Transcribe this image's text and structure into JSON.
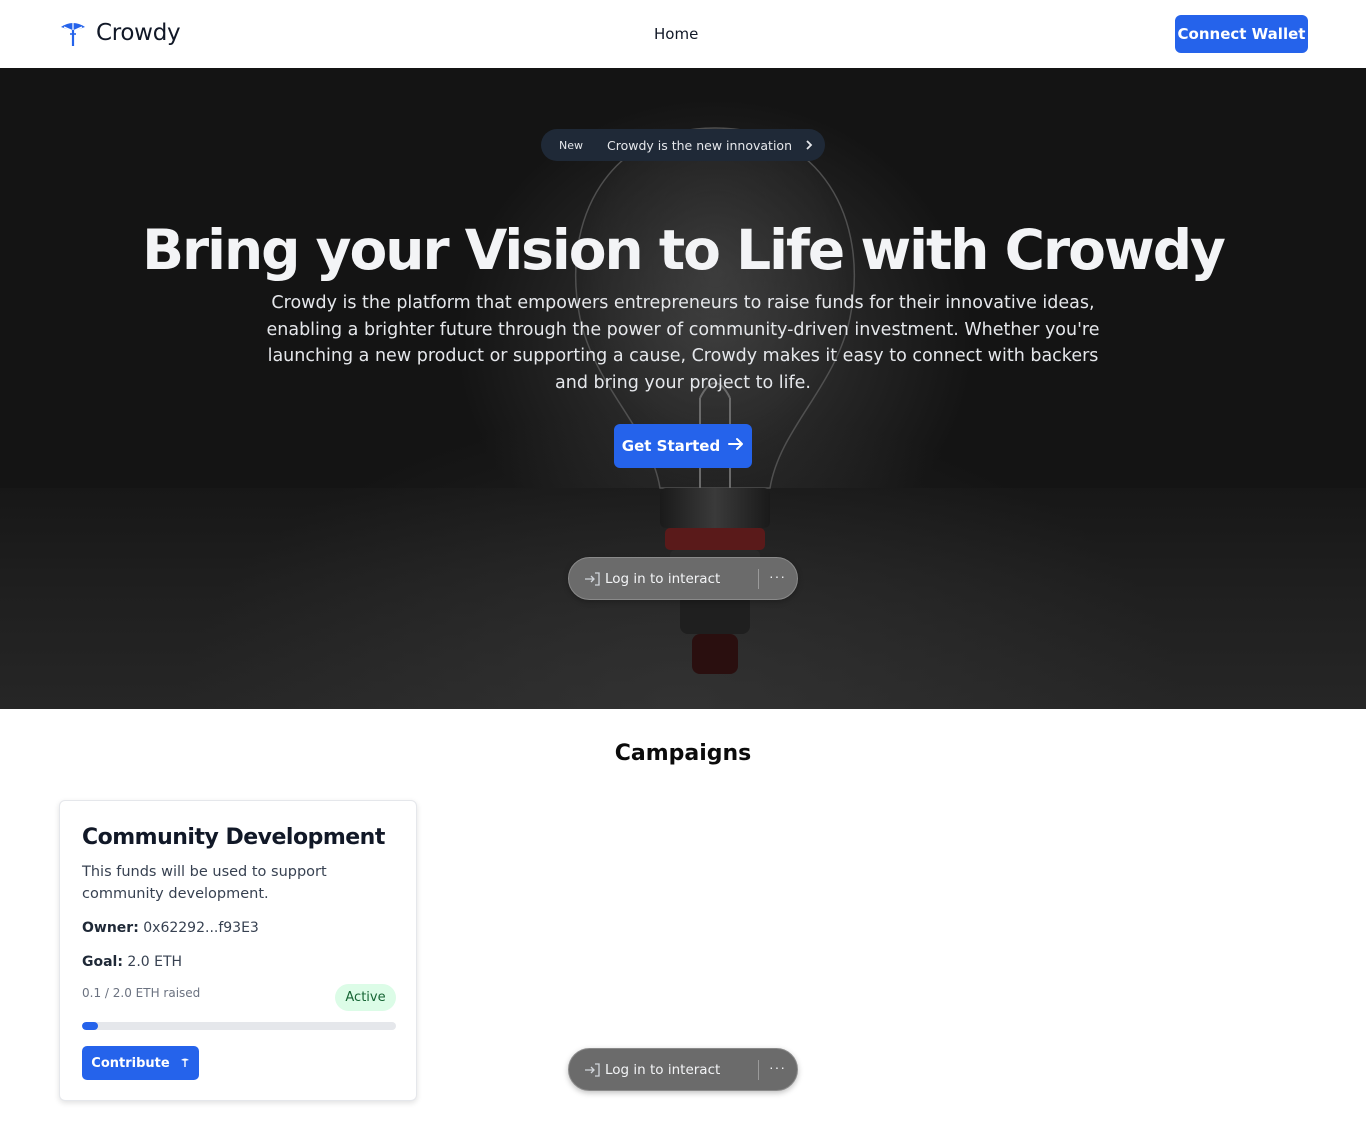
{
  "header": {
    "logo_text": "Crowdy",
    "nav_home": "Home",
    "connect_wallet_label": "Connect Wallet"
  },
  "hero": {
    "badge_tag": "New",
    "badge_text": "Crowdy is the new innovation",
    "title": "Bring your Vision to Life with Crowdy",
    "description": "Crowdy is the platform that empowers entrepreneurs to raise funds for their innovative ideas, enabling a brighter future through the power of community-driven investment. Whether you're launching a new product or supporting a cause, Crowdy makes it easy to connect with backers and bring your project to life.",
    "cta_label": "Get Started"
  },
  "login_overlay": {
    "label": "Log in to interact",
    "more": "···"
  },
  "campaigns": {
    "section_title": "Campaigns",
    "items": [
      {
        "title": "Community Development",
        "description": "This funds will be used to support community development.",
        "owner_label": "Owner:",
        "owner_value": "0x62292...f93E3",
        "goal_label": "Goal:",
        "goal_value": "2.0 ETH",
        "raised_text": "0.1 / 2.0 ETH raised",
        "progress_fraction": 0.05,
        "status": "Active",
        "contribute_label": "Contribute"
      }
    ]
  },
  "colors": {
    "accent": "#2563eb",
    "status_bg": "#dcfce7",
    "status_text": "#166534"
  },
  "icons": [
    "logo-icon",
    "chevron-right-icon",
    "arrow-right-icon",
    "login-arrow-icon",
    "more-icon",
    "contribute-icon"
  ]
}
